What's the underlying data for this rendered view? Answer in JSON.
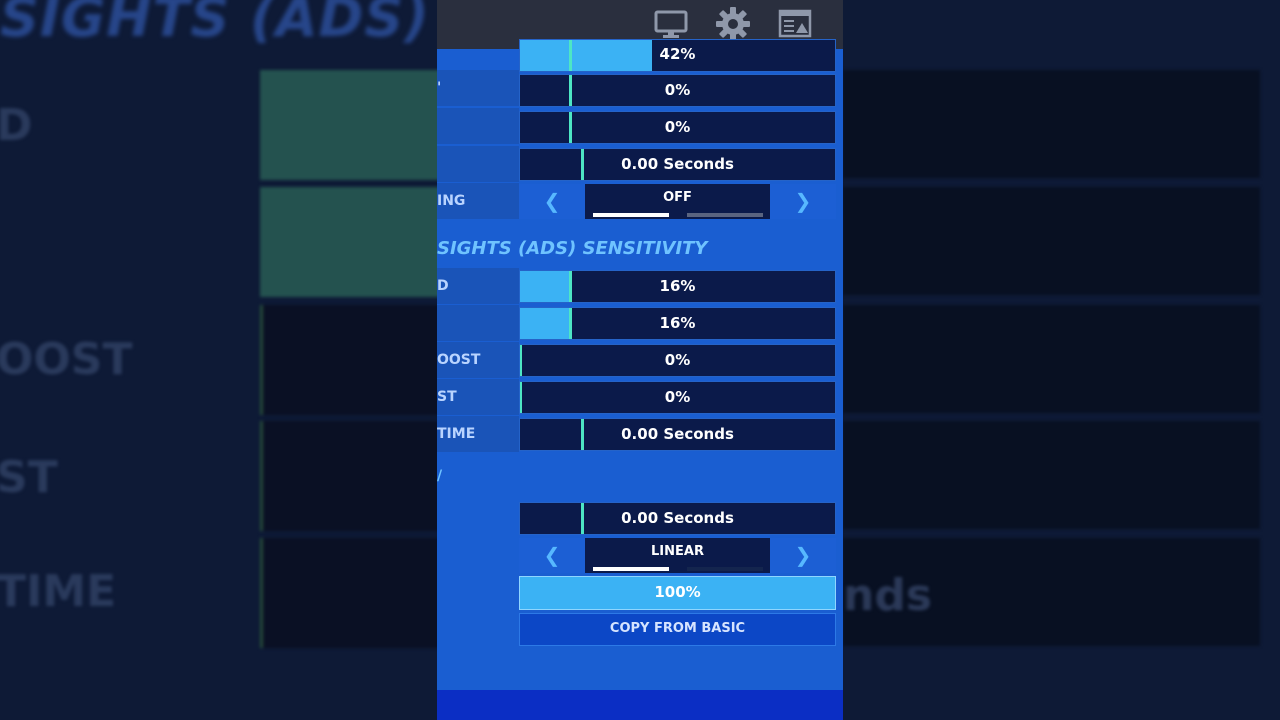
{
  "background": {
    "heading": "SIGHTS (ADS) SENSITIVITY",
    "labels": [
      "D",
      "OOST",
      "ST",
      "TIME"
    ],
    "right_text": "nds"
  },
  "toolbar": {
    "icons": [
      "monitor-icon",
      "gear-icon",
      "display-settings-icon"
    ]
  },
  "rows_top": [
    {
      "label": "",
      "value": "42%",
      "fill": 0.42
    },
    {
      "label": "'",
      "value": "0%",
      "fill": 0.0
    },
    {
      "label": "",
      "value": "0%",
      "fill": 0.0
    },
    {
      "label": "",
      "value": "0.00 Seconds",
      "fill": 0.0
    }
  ],
  "targeting_row": {
    "label": "ING",
    "value": "OFF"
  },
  "ads_section": {
    "title": "SIGHTS (ADS) SENSITIVITY",
    "rows": [
      {
        "label": "D",
        "value": "16%",
        "fill": 0.16
      },
      {
        "label": "",
        "value": "16%",
        "fill": 0.16
      },
      {
        "label": "OOST",
        "value": "0%",
        "fill": 0.0
      },
      {
        "label": "ST",
        "value": "0%",
        "fill": 0.0
      },
      {
        "label": "TIME",
        "value": "0.00 Seconds",
        "fill": 0.0
      }
    ]
  },
  "second_section": {
    "title": "/",
    "delay_value": "0.00 Seconds",
    "curve_value": "LINEAR",
    "percent_value": "100%",
    "percent_fill": 1.0,
    "copy_button": "COPY FROM BASIC"
  },
  "colors": {
    "panel": "#1a5ed1",
    "slider_track": "#0b1a4a",
    "slider_fill": "#3bb2f4",
    "marker": "#4de6c4",
    "section_title": "#6fc3ff"
  }
}
